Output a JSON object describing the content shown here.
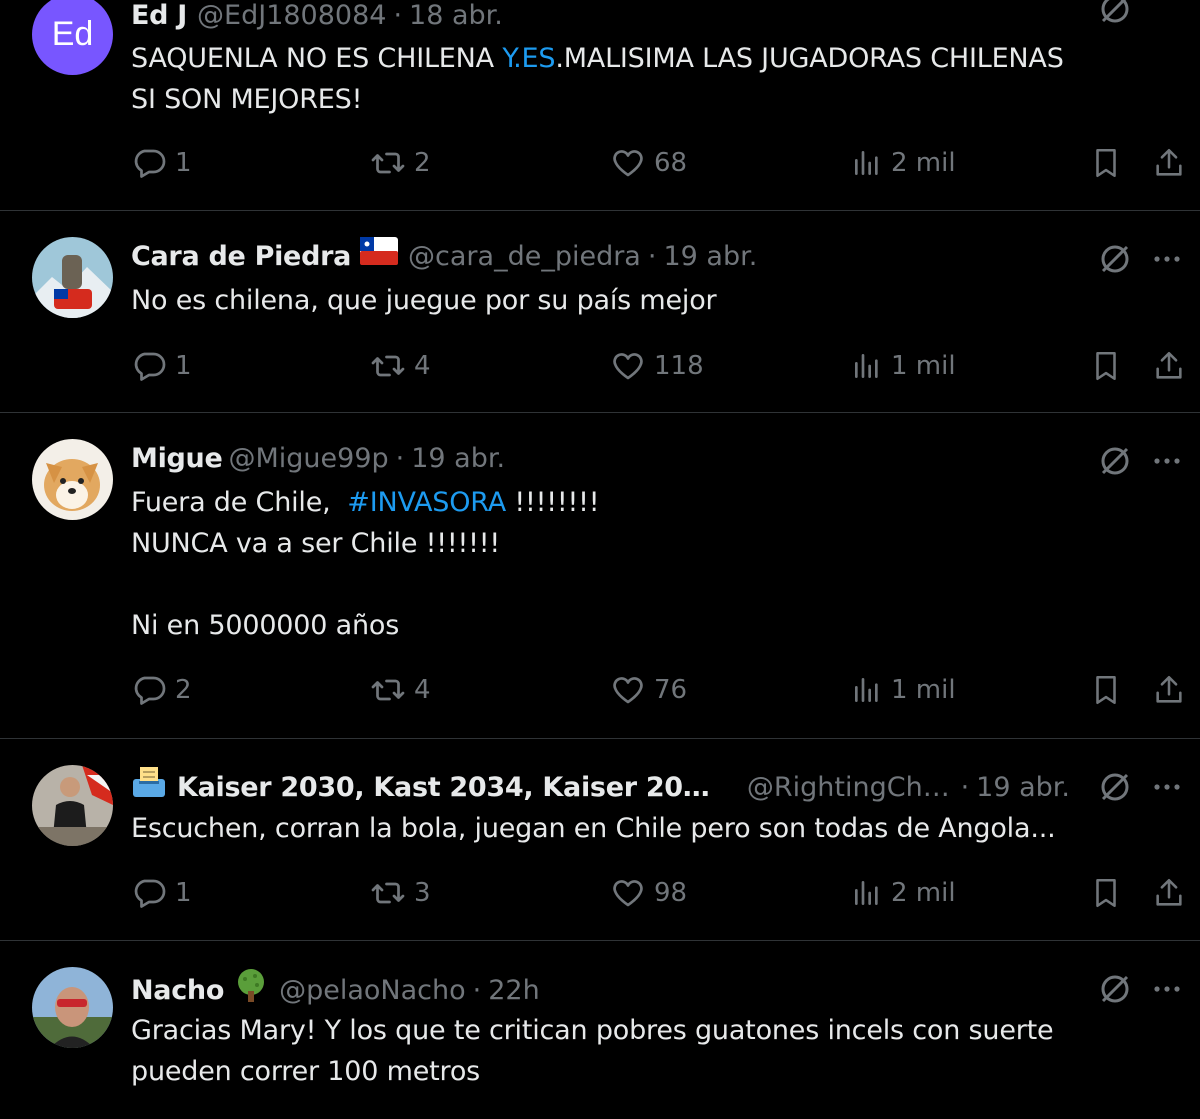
{
  "colors": {
    "background": "#000000",
    "text": "#e7e9ea",
    "muted": "#71767b",
    "link": "#1d9bf0",
    "divider": "#2f3336"
  },
  "tweets": [
    {
      "avatar_initials": "Ed",
      "name": "Ed J",
      "handle": "@EdJ1808084",
      "time": "18 abr.",
      "body": {
        "l1_a": "SAQUENLA NO ES CHILENA ",
        "l1_link": "Y.ES",
        "l1_b": ".MALISIMA LAS JUGADORAS CHILENAS",
        "l2": "SI SON MEJORES!"
      },
      "replies": "1",
      "retweets": "2",
      "likes": "68",
      "views": "2 mil"
    },
    {
      "name": "Cara de Piedra",
      "handle": "@cara_de_piedra",
      "sep": "·",
      "time": "19 abr.",
      "body": {
        "l1": "No es chilena, que juegue por su país mejor"
      },
      "replies": "1",
      "retweets": "4",
      "likes": "118",
      "views": "1 mil"
    },
    {
      "name": "Migue",
      "handle": "@Migue99p",
      "sep": "·",
      "time": "19 abr.",
      "body": {
        "l1_a": "Fuera de Chile,  ",
        "l1_link": "#INVASORA",
        "l1_b": " !!!!!!!!",
        "l2": "NUNCA va a ser Chile !!!!!!!",
        "l4": "Ni en 5000000 años"
      },
      "replies": "2",
      "retweets": "4",
      "likes": "76",
      "views": "1 mil"
    },
    {
      "name": "Kaiser 2030, Kast 2034, Kaiser 203...",
      "handle": "@RightingChi...",
      "sep": "·",
      "time": "19 abr.",
      "body": {
        "l1": "Escuchen, corran la bola, juegan en Chile pero son todas de Angola..."
      },
      "replies": "1",
      "retweets": "3",
      "likes": "98",
      "views": "2 mil"
    },
    {
      "name": "Nacho",
      "handle": "@pelaoNacho",
      "sep": "·",
      "time": "22h",
      "body": {
        "l1": "Gracias Mary! Y los que te critican pobres guatones incels con suerte",
        "l2": "pueden correr 100 metros"
      }
    }
  ]
}
